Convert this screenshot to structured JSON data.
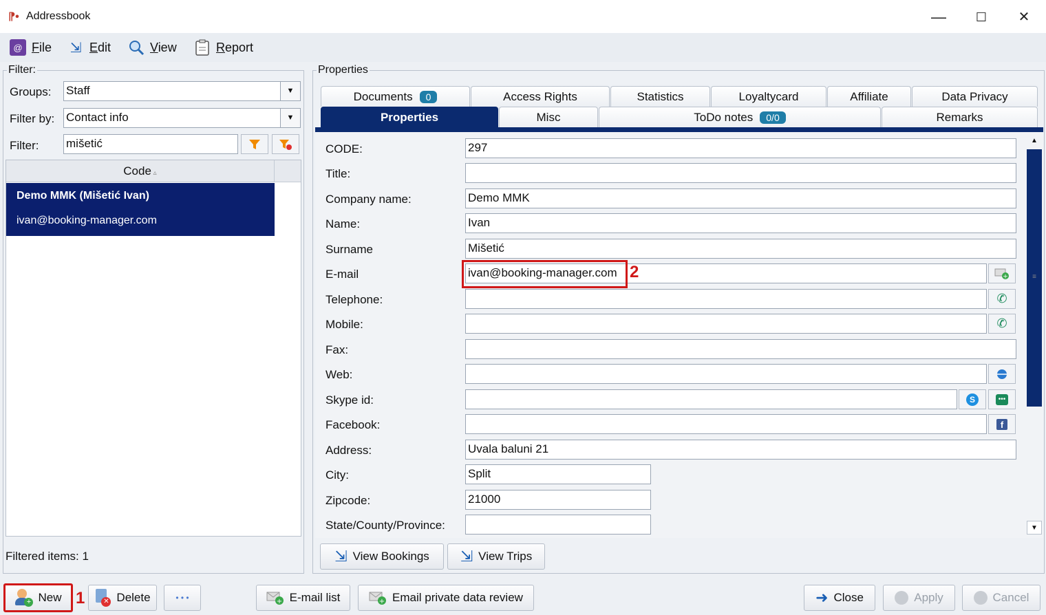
{
  "window": {
    "title": "Addressbook",
    "controls": {
      "minimize": "—",
      "maximize": "☐",
      "close": "✕"
    }
  },
  "menu": {
    "file": "File",
    "edit": "Edit",
    "view": "View",
    "report": "Report"
  },
  "filter": {
    "group_title": "Filter:",
    "groups_label": "Groups:",
    "groups_value": "Staff",
    "filterby_label": "Filter by:",
    "filterby_value": "Contact info",
    "filter_label": "Filter:",
    "filter_value": "mišetić",
    "column_header": "Code",
    "rows": [
      {
        "line1": "Demo MMK (Mišetić Ivan)",
        "line2": "ivan@booking-manager.com"
      }
    ],
    "footer": "Filtered items: 1"
  },
  "properties": {
    "group_title": "Properties",
    "tabs_row1": [
      {
        "label": "Documents",
        "badge": "0"
      },
      {
        "label": "Access Rights"
      },
      {
        "label": "Statistics"
      },
      {
        "label": "Loyaltycard"
      },
      {
        "label": "Affiliate"
      },
      {
        "label": "Data Privacy"
      }
    ],
    "tabs_row2": [
      {
        "label": "Properties",
        "active": true
      },
      {
        "label": "Misc"
      },
      {
        "label": "ToDo notes",
        "badge": "0/0"
      },
      {
        "label": "Remarks"
      }
    ],
    "fields": {
      "code": {
        "label": "CODE:",
        "value": "297"
      },
      "title": {
        "label": "Title:",
        "value": ""
      },
      "company": {
        "label": "Company name:",
        "value": "Demo MMK"
      },
      "name": {
        "label": "Name:",
        "value": "Ivan"
      },
      "surname": {
        "label": "Surname",
        "value": "Mišetić"
      },
      "email": {
        "label": "E-mail",
        "value": "ivan@booking-manager.com"
      },
      "telephone": {
        "label": "Telephone:",
        "value": ""
      },
      "mobile": {
        "label": "Mobile:",
        "value": ""
      },
      "fax": {
        "label": "Fax:",
        "value": ""
      },
      "web": {
        "label": "Web:",
        "value": ""
      },
      "skype": {
        "label": "Skype id:",
        "value": ""
      },
      "facebook": {
        "label": "Facebook:",
        "value": ""
      },
      "address": {
        "label": "Address:",
        "value": "Uvala baluni 21"
      },
      "city": {
        "label": "City:",
        "value": "Split"
      },
      "zipcode": {
        "label": "Zipcode:",
        "value": "21000"
      },
      "state": {
        "label": "State/County/Province:",
        "value": ""
      }
    },
    "view_bookings": "View Bookings",
    "view_trips": "View Trips"
  },
  "bottom": {
    "new": "New",
    "delete": "Delete",
    "more": "• • •",
    "email_list": "E-mail list",
    "email_private": "Email private data review",
    "close": "Close",
    "apply": "Apply",
    "cancel": "Cancel"
  },
  "callouts": {
    "one": "1",
    "two": "2"
  },
  "colors": {
    "selection": "#0b1f6e",
    "active_tab": "#0b2a6f",
    "badge": "#1f7ea8",
    "callout_red": "#d01818"
  }
}
